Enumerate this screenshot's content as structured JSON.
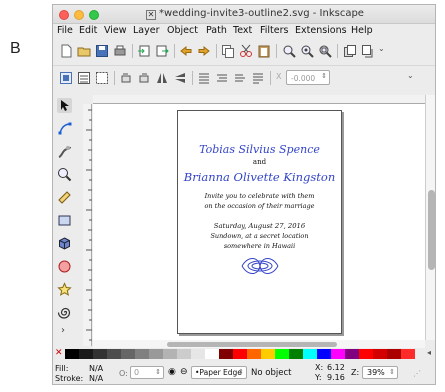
{
  "panel_label": "B",
  "window": {
    "title": "*wedding-invite3-outline2.svg - Inkscape"
  },
  "menu": [
    "File",
    "Edit",
    "View",
    "Layer",
    "Object",
    "Path",
    "Text",
    "Filters",
    "Extensions",
    "Help"
  ],
  "toolbar_commands": [
    "new-document-icon",
    "open-icon",
    "save-icon",
    "print-icon",
    "import-icon",
    "export-icon",
    "undo-icon",
    "redo-icon",
    "copy-icon",
    "cut-icon",
    "paste-icon",
    "zoom-selection-icon",
    "zoom-drawing-icon",
    "zoom-page-icon",
    "duplicate-icon",
    "clone-icon"
  ],
  "toolbar_controls": {
    "x_label": "X",
    "x_value": "-0.000"
  },
  "tools": [
    "selector-tool-icon",
    "node-tool-icon",
    "tweak-tool-icon",
    "zoom-tool-icon",
    "measure-tool-icon",
    "rectangle-tool-icon",
    "3d-box-tool-icon",
    "ellipse-tool-icon",
    "star-tool-icon",
    "spiral-tool-icon",
    "expand-tools-icon"
  ],
  "document": {
    "name1": "Tobias Silvius Spence",
    "and": "and",
    "name2": "Brianna Olivette Kingston",
    "invite_line1": "Invite you to celebrate with them",
    "invite_line2": "on the occasion of their marriage",
    "date": "Saturday, August 27, 2016",
    "time_place": "Sundown, at a secret location",
    "location": "somewhere in Hawaii",
    "accent_color": "#3344c8"
  },
  "palette": [
    "#000000",
    "#1a1a1a",
    "#333333",
    "#4d4d4d",
    "#666666",
    "#808080",
    "#999999",
    "#b3b3b3",
    "#cccccc",
    "#e6e6e6",
    "#ffffff",
    "#800000",
    "#ff0000",
    "#ff6600",
    "#ffcc00",
    "#00ff00",
    "#008000",
    "#00ffff",
    "#0000ff",
    "#ff00ff",
    "#800080",
    "#ff0000",
    "#d40000",
    "#aa0000",
    "#ff2a2a"
  ],
  "status": {
    "fill_label": "Fill:",
    "stroke_label": "Stroke:",
    "fill_value": "N/A",
    "stroke_value": "N/A",
    "opacity_label": "O:",
    "opacity_value": "0",
    "layer_value": "•Paper Edge",
    "message": "No object",
    "x_label": "X:",
    "x_value": "6.12",
    "y_label": "Y:",
    "y_value": "9.16",
    "zoom_label": "Z:",
    "zoom_value": "39%"
  }
}
